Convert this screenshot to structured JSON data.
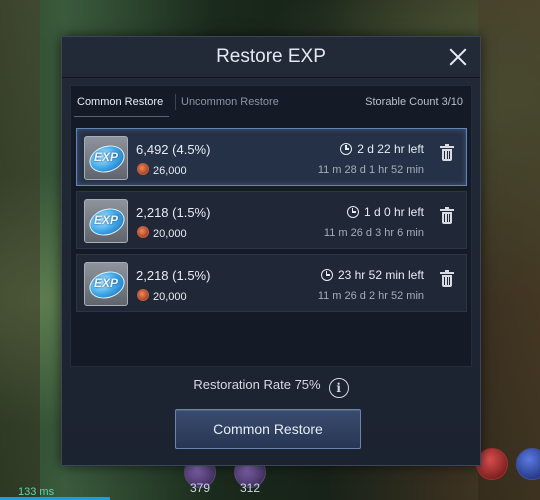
{
  "dialog": {
    "title": "Restore EXP",
    "tabs": [
      {
        "label": "Common Restore",
        "active": true
      },
      {
        "label": "Uncommon Restore",
        "active": false
      }
    ],
    "storable_count": "Storable Count 3/10",
    "items": [
      {
        "icon": "EXP",
        "amount": "6,492 (4.5%)",
        "cost": "26,000",
        "time_left": "2 d 22 hr left",
        "expiry": "11 m 28 d 1 hr 52 min",
        "selected": true
      },
      {
        "icon": "EXP",
        "amount": "2,218 (1.5%)",
        "cost": "20,000",
        "time_left": "1 d 0 hr left",
        "expiry": "11 m 26 d 3 hr 6 min",
        "selected": false
      },
      {
        "icon": "EXP",
        "amount": "2,218 (1.5%)",
        "cost": "20,000",
        "time_left": "23 hr 52 min left",
        "expiry": "11 m 26 d 2 hr 52 min",
        "selected": false
      }
    ],
    "restoration_rate": "Restoration Rate 75%",
    "info_symbol": "i",
    "restore_button": "Common Restore"
  },
  "hud": {
    "left_count": "379",
    "right_count": "312",
    "ms": "133 ms"
  },
  "colors": {
    "selected_border": "#5f86b8",
    "button_bg": "#2f3f60",
    "panel_bg": "#151b26"
  }
}
